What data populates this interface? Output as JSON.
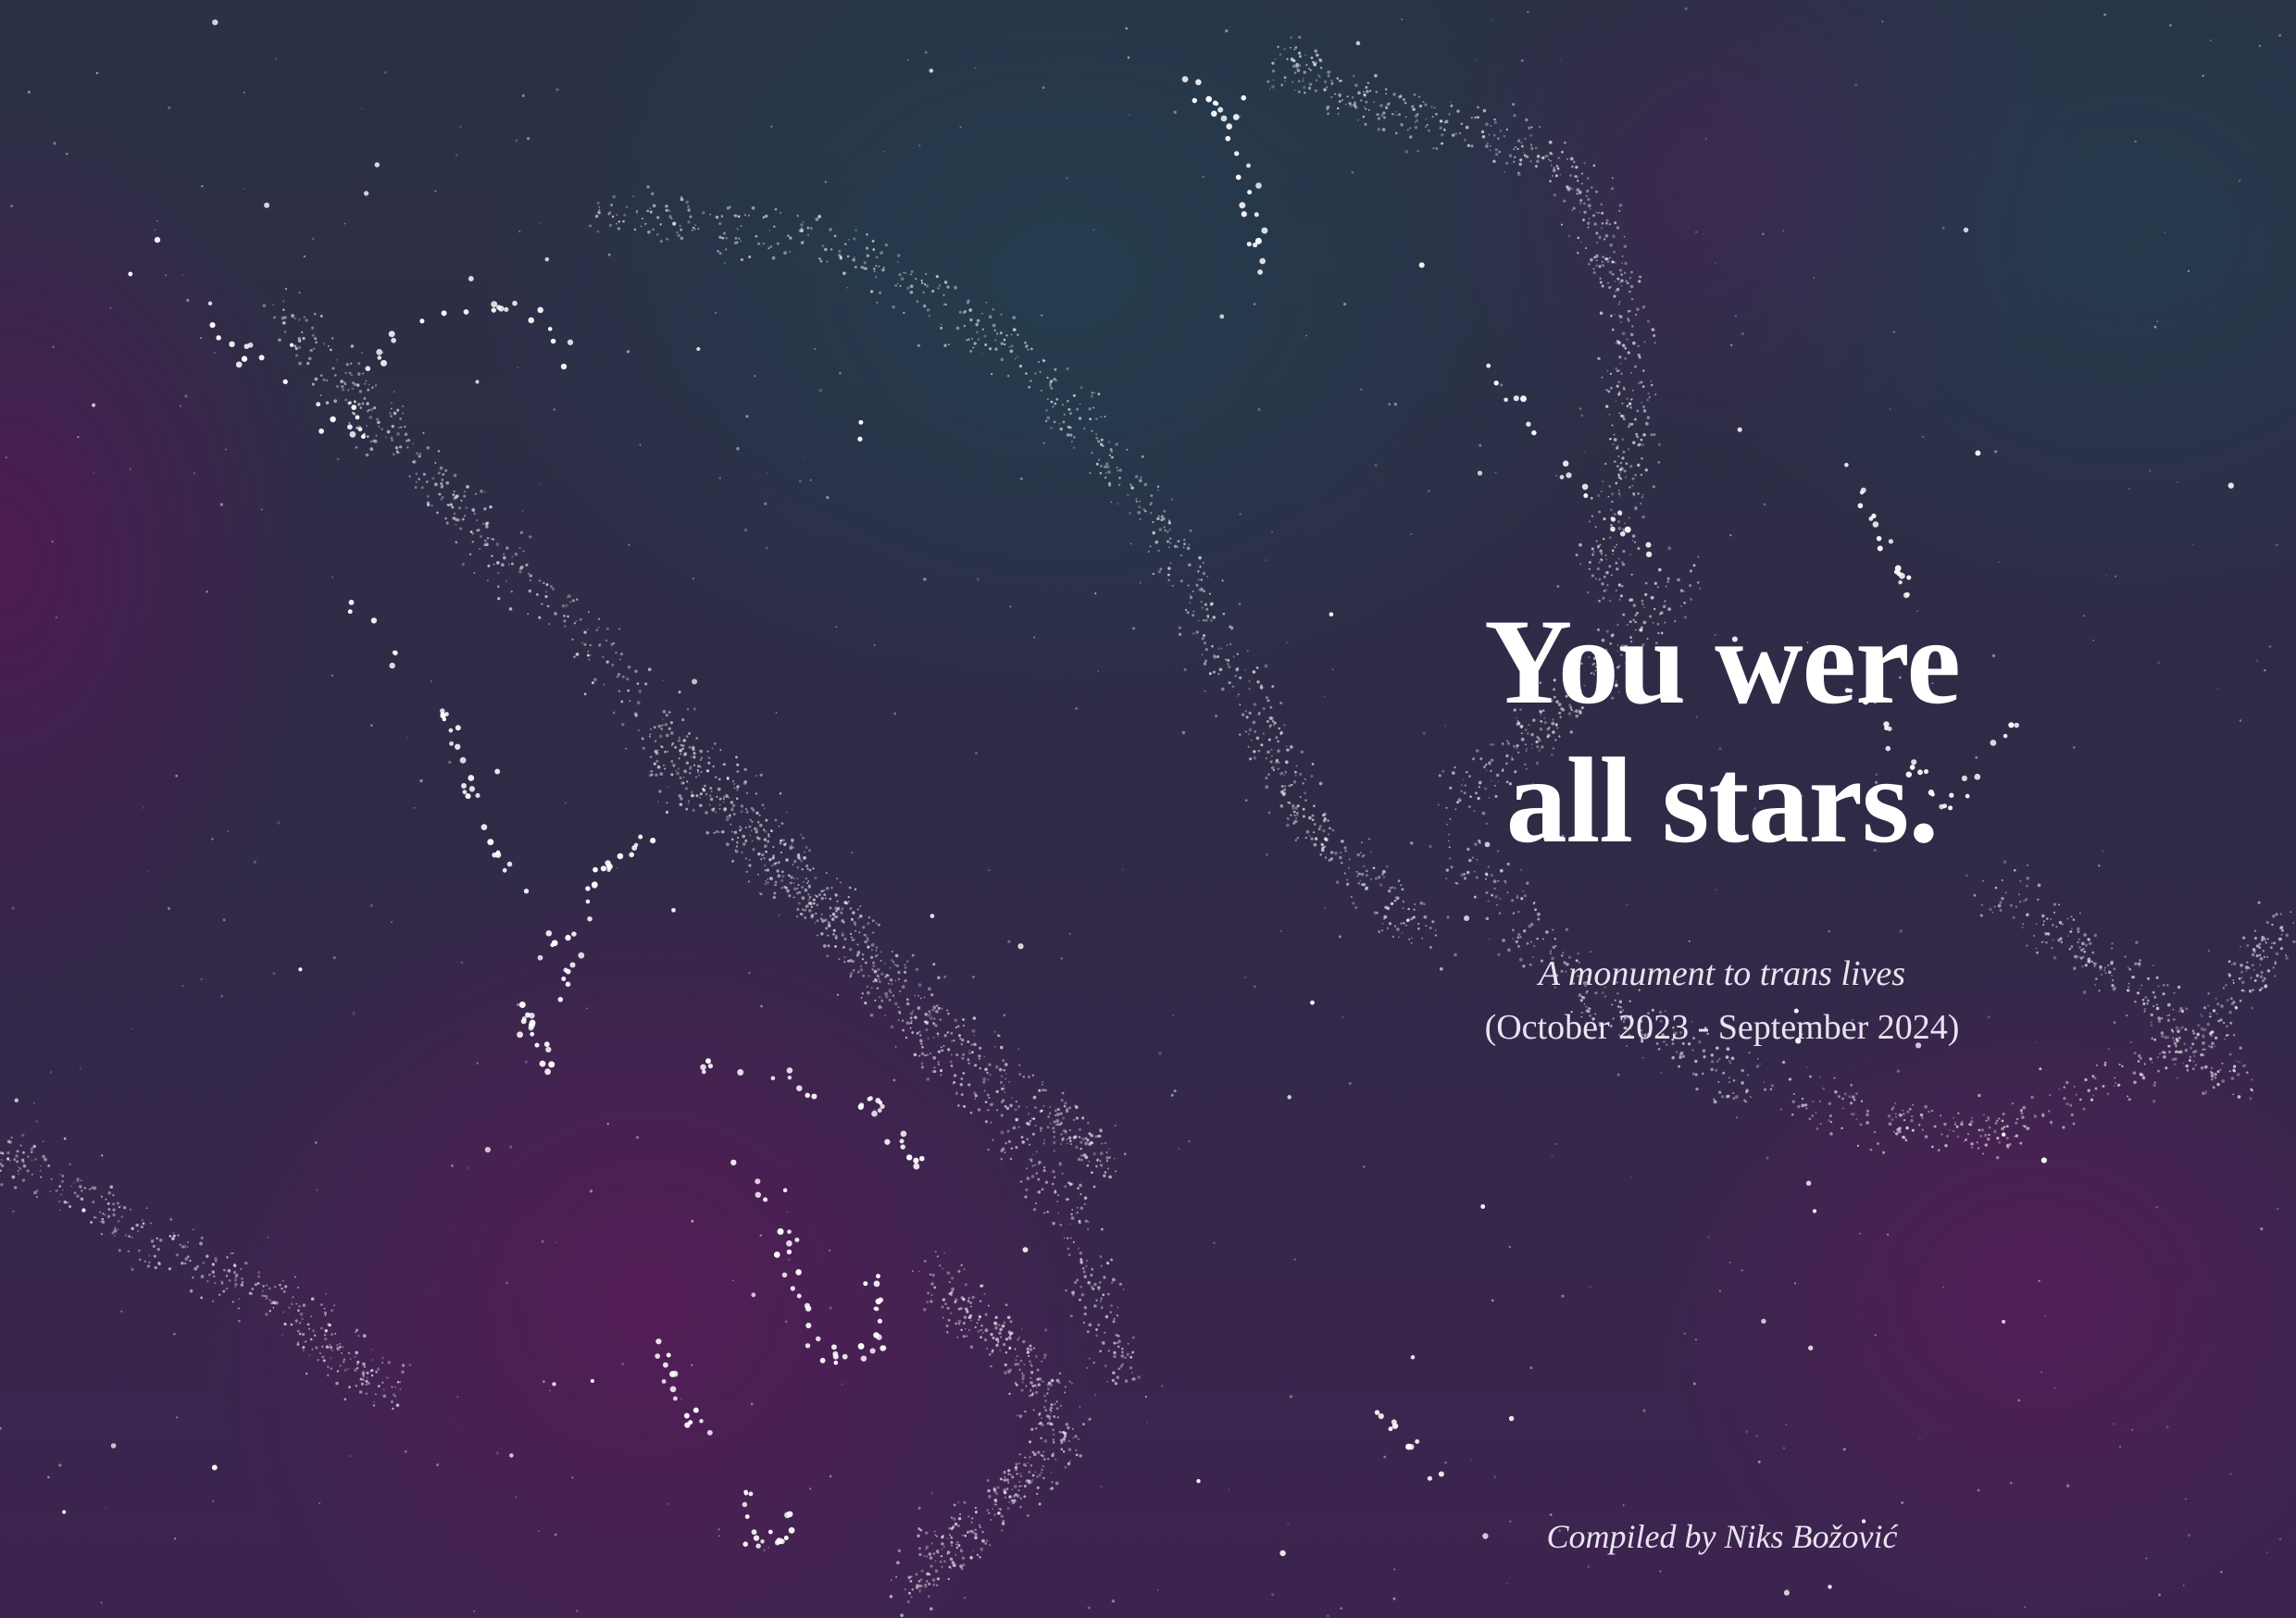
{
  "title_line_1": "You were",
  "title_line_2": "all stars.",
  "subtitle": "A monument to trans lives",
  "dates": "(October 2023 - September 2024)",
  "credit": "Compiled by Niks Božović",
  "colors": {
    "background_teal": "#233e4e",
    "background_purple": "#561c58",
    "text": "#ffffff",
    "star": "#ffffff"
  }
}
